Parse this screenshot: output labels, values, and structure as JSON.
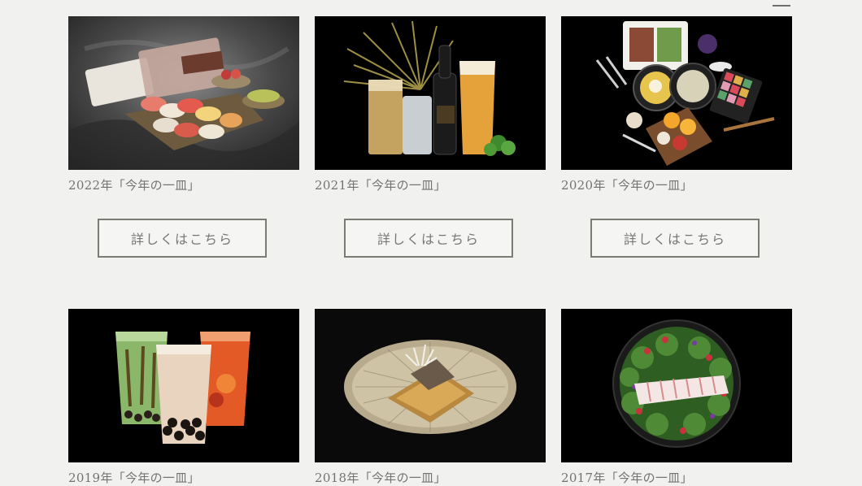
{
  "menu": {
    "icon": "hamburger-menu-icon"
  },
  "items": [
    {
      "caption": "2022年「今年の一皿」",
      "button_label": "詳しくはこちら",
      "photo": "sushi-and-meat-platter-photo"
    },
    {
      "caption": "2021年「今年の一皿」",
      "button_label": "詳しくはこちら",
      "photo": "beer-and-highball-drinks-photo"
    },
    {
      "caption": "2020年「今年の一皿」",
      "button_label": "詳しくはこちら",
      "photo": "takeout-bento-meals-photo"
    },
    {
      "caption": "2019年「今年の一皿」",
      "photo": "tapioca-bubble-tea-drinks-photo"
    },
    {
      "caption": "2018年「今年の一皿」",
      "photo": "grilled-mackerel-dish-photo"
    },
    {
      "caption": "2017年「今年の一皿」",
      "photo": "salad-with-sliced-meat-photo"
    }
  ],
  "colors": {
    "background": "#f1f1f0",
    "text": "#737373",
    "button_border": "#7b7b73",
    "photo_background": "#000000"
  }
}
